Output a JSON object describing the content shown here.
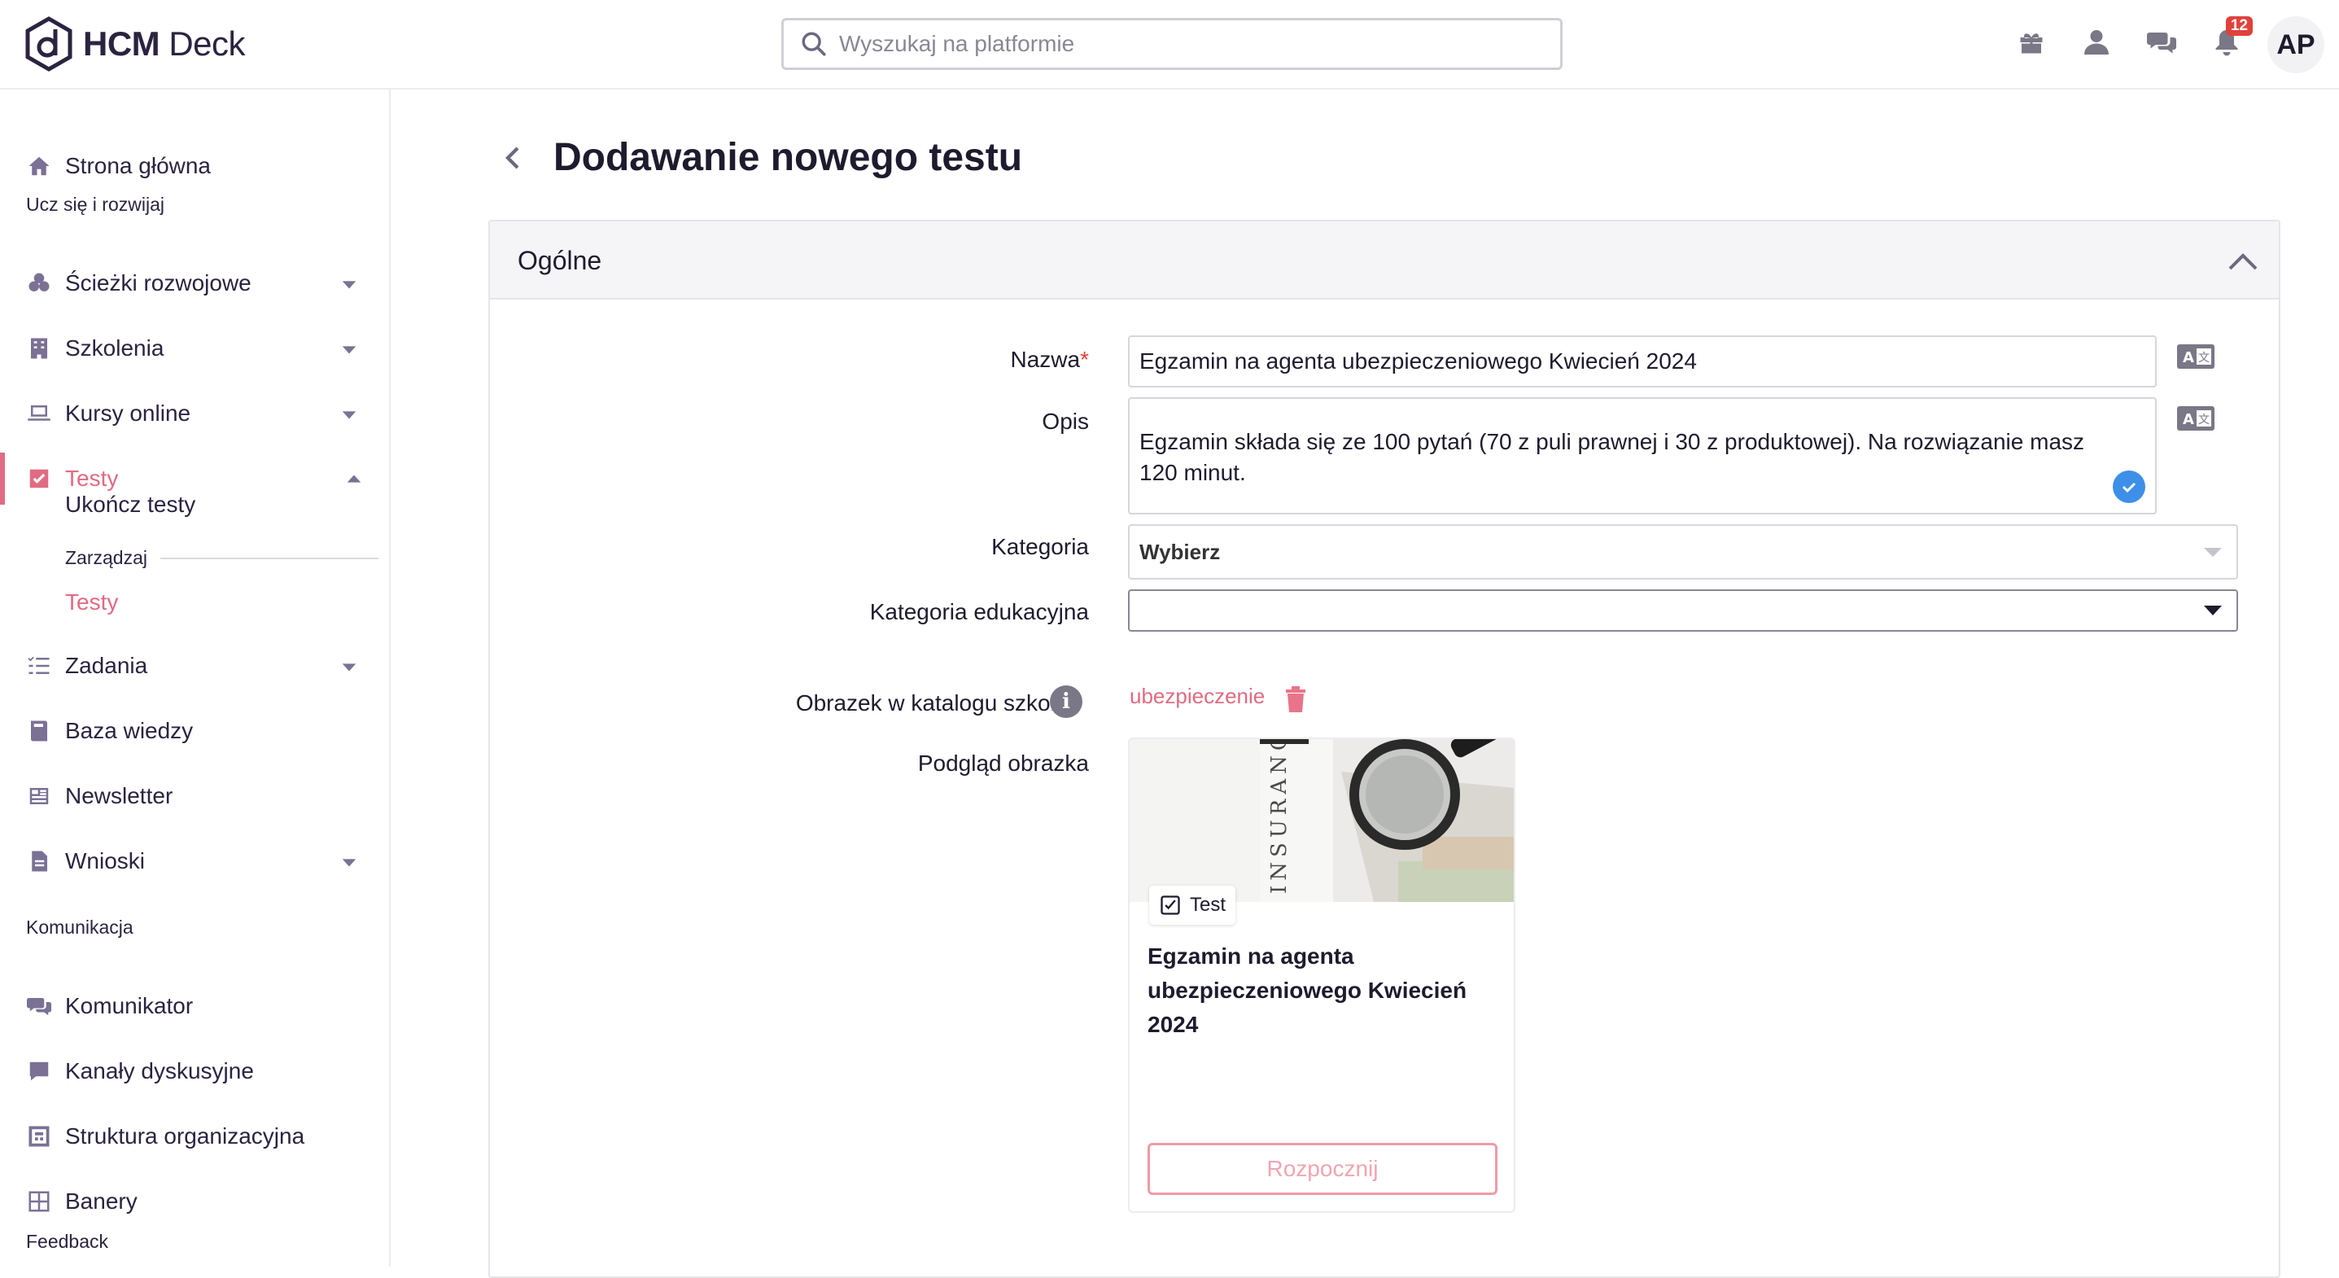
{
  "app": {
    "logo_bold": "HCM",
    "logo_rest": " Deck"
  },
  "search": {
    "placeholder": "Wyszukaj na platformie"
  },
  "topbar": {
    "icons": [
      "gift-icon",
      "user-icon",
      "chat-icon",
      "bell-icon"
    ],
    "notifications_count": "12",
    "avatar_initials": "AP"
  },
  "sidebar": {
    "home": "Strona główna",
    "section_learn": "Ucz się i rozwijaj",
    "paths": "Ścieżki rozwojowe",
    "trainings": "Szkolenia",
    "courses": "Kursy online",
    "tests": "Testy",
    "complete_tests": "Ukończ testy",
    "manage": "Zarządzaj",
    "manage_tests": "Testy",
    "tasks": "Zadania",
    "knowledge": "Baza wiedzy",
    "newsletter": "Newsletter",
    "requests": "Wnioski",
    "section_comm": "Komunikacja",
    "messenger": "Komunikator",
    "channels": "Kanały dyskusyjne",
    "org": "Struktura organizacyjna",
    "banners": "Banery",
    "section_feedback": "Feedback"
  },
  "page": {
    "title": "Dodawanie nowego testu"
  },
  "form": {
    "section_title": "Ogólne",
    "name_label": "Nazwa",
    "name_required": "*",
    "name_value": "Egzamin na agenta ubezpieczeniowego Kwiecień 2024",
    "desc_label": "Opis",
    "desc_value": "Egzamin składa się ze 100 pytań (70 z puli prawnej i 30 z produktowej). Na rozwiązanie masz 120 minut.",
    "category_label": "Kategoria",
    "category_value": "Wybierz",
    "edu_category_label": "Kategoria edukacyjna",
    "edu_category_value": "",
    "image_label": "Obrazek w katalogu szkoleń",
    "image_file": "ubezpieczenie",
    "preview_label": "Podgląd obrazka"
  },
  "preview": {
    "tag": "Test",
    "title": "Egzamin na agenta ubezpieczeniowego Kwiecień 2024",
    "start_button": "Rozpocznij",
    "image_text": "INSURANCE POLICY"
  },
  "colors": {
    "accent": "#e06b82",
    "primary_text": "#1f1b2e",
    "check_blue": "#3d8fe8",
    "badge_red": "#e0413b"
  }
}
